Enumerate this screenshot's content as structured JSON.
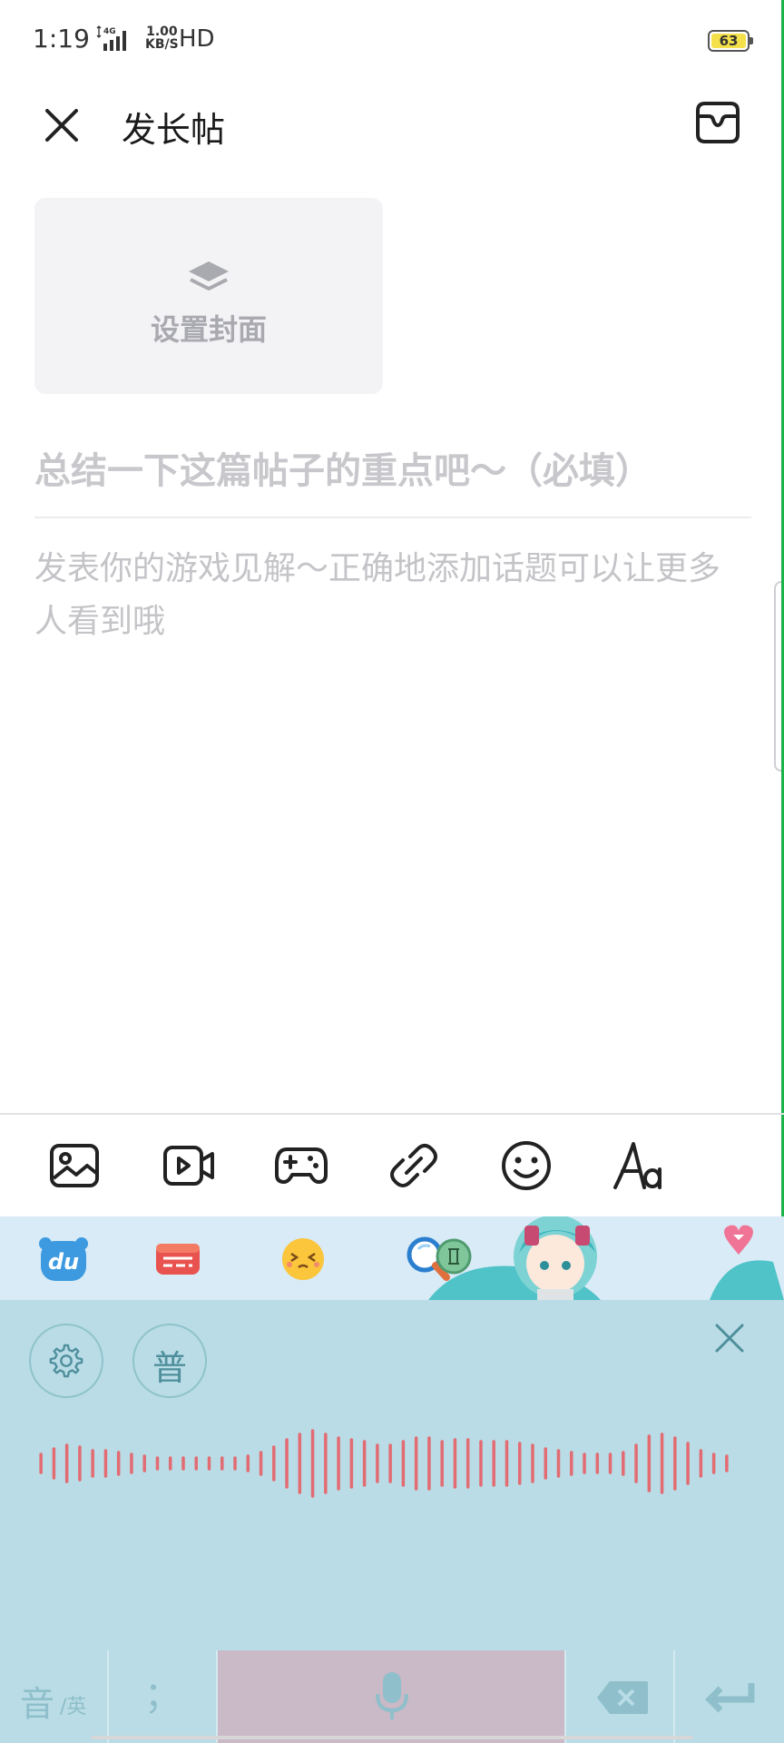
{
  "status_bar": {
    "time": "1:19",
    "network": "4G",
    "speed_value": "1.00",
    "speed_unit": "KB/S",
    "hd": "HD",
    "battery": "63"
  },
  "header": {
    "title": "发长帖",
    "close_icon": "close-icon",
    "drafts_icon": "drafts-box-icon"
  },
  "cover": {
    "label": "设置封面",
    "icon": "layers-icon"
  },
  "editor": {
    "title_placeholder": "总结一下这篇帖子的重点吧～（必填）",
    "body_placeholder": "发表你的游戏见解～正确地添加话题可以让更多人看到哦"
  },
  "toolbar": {
    "items": [
      "image-icon",
      "video-icon",
      "gamepad-icon",
      "link-icon",
      "emoji-icon",
      "text-format-icon"
    ]
  },
  "keyboard": {
    "top_icons": [
      "baidu-input-icon",
      "keyboard-switch-icon",
      "emoji-face-icon",
      "search-icon",
      "cursor-icon"
    ],
    "voice_mode_label": "普",
    "lang_key_main": "音",
    "lang_key_sub": "/英",
    "punct_key": "；",
    "colors": {
      "panel": "#b9dce6",
      "wave": "#e36b72",
      "mic_key": "#cab9c6"
    }
  }
}
